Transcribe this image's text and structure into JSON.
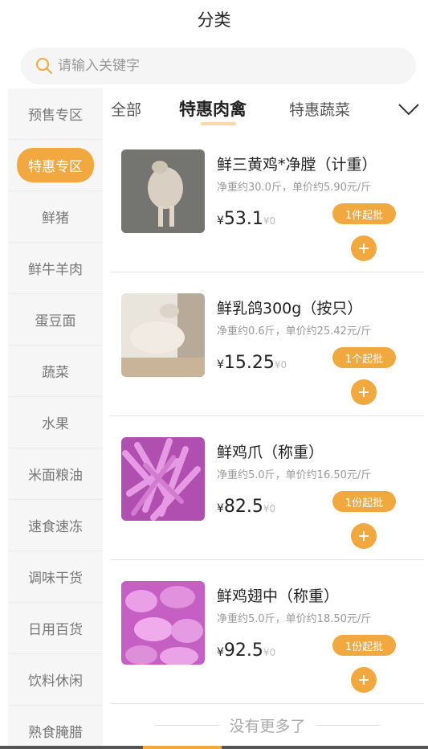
{
  "header": {
    "title": "分类"
  },
  "search": {
    "placeholder": "请输入关键字"
  },
  "sidebar": {
    "items": [
      {
        "label": "预售专区"
      },
      {
        "label": "特惠专区",
        "active": true
      },
      {
        "label": "鲜猪"
      },
      {
        "label": "鲜牛羊肉"
      },
      {
        "label": "蛋豆面"
      },
      {
        "label": "蔬菜"
      },
      {
        "label": "水果"
      },
      {
        "label": "米面粮油"
      },
      {
        "label": "速食速冻"
      },
      {
        "label": "调味干货"
      },
      {
        "label": "日用百货"
      },
      {
        "label": "饮料休闲"
      },
      {
        "label": "熟食腌腊"
      }
    ]
  },
  "tabs": [
    {
      "label": "全部"
    },
    {
      "label": "特惠肉禽",
      "active": true
    },
    {
      "label": "特惠蔬菜"
    }
  ],
  "products": [
    {
      "name": "鲜三黄鸡*净膛（计重）",
      "spec": "净重约30.0斤，单价约5.90元/斤",
      "currency": "¥",
      "price": "53.1",
      "old_price": "¥0",
      "moq": "1件起批"
    },
    {
      "name": "鲜乳鸽300g（按只）",
      "spec": "净重约0.6斤，单价约25.42元/斤",
      "currency": "¥",
      "price": "15.25",
      "old_price": "¥0",
      "moq": "1个起批"
    },
    {
      "name": "鲜鸡爪（称重）",
      "spec": "净重约5.0斤，单价约16.50元/斤",
      "currency": "¥",
      "price": "82.5",
      "old_price": "¥0",
      "moq": "1份起批"
    },
    {
      "name": "鲜鸡翅中（称重）",
      "spec": "净重约5.0斤，单价约18.50元/斤",
      "currency": "¥",
      "price": "92.5",
      "old_price": "¥0",
      "moq": "1份起批"
    }
  ],
  "list_footer": {
    "no_more": "没有更多了"
  },
  "colors": {
    "accent": "#f0a83f",
    "tab_underline": "#f7d9a8"
  }
}
